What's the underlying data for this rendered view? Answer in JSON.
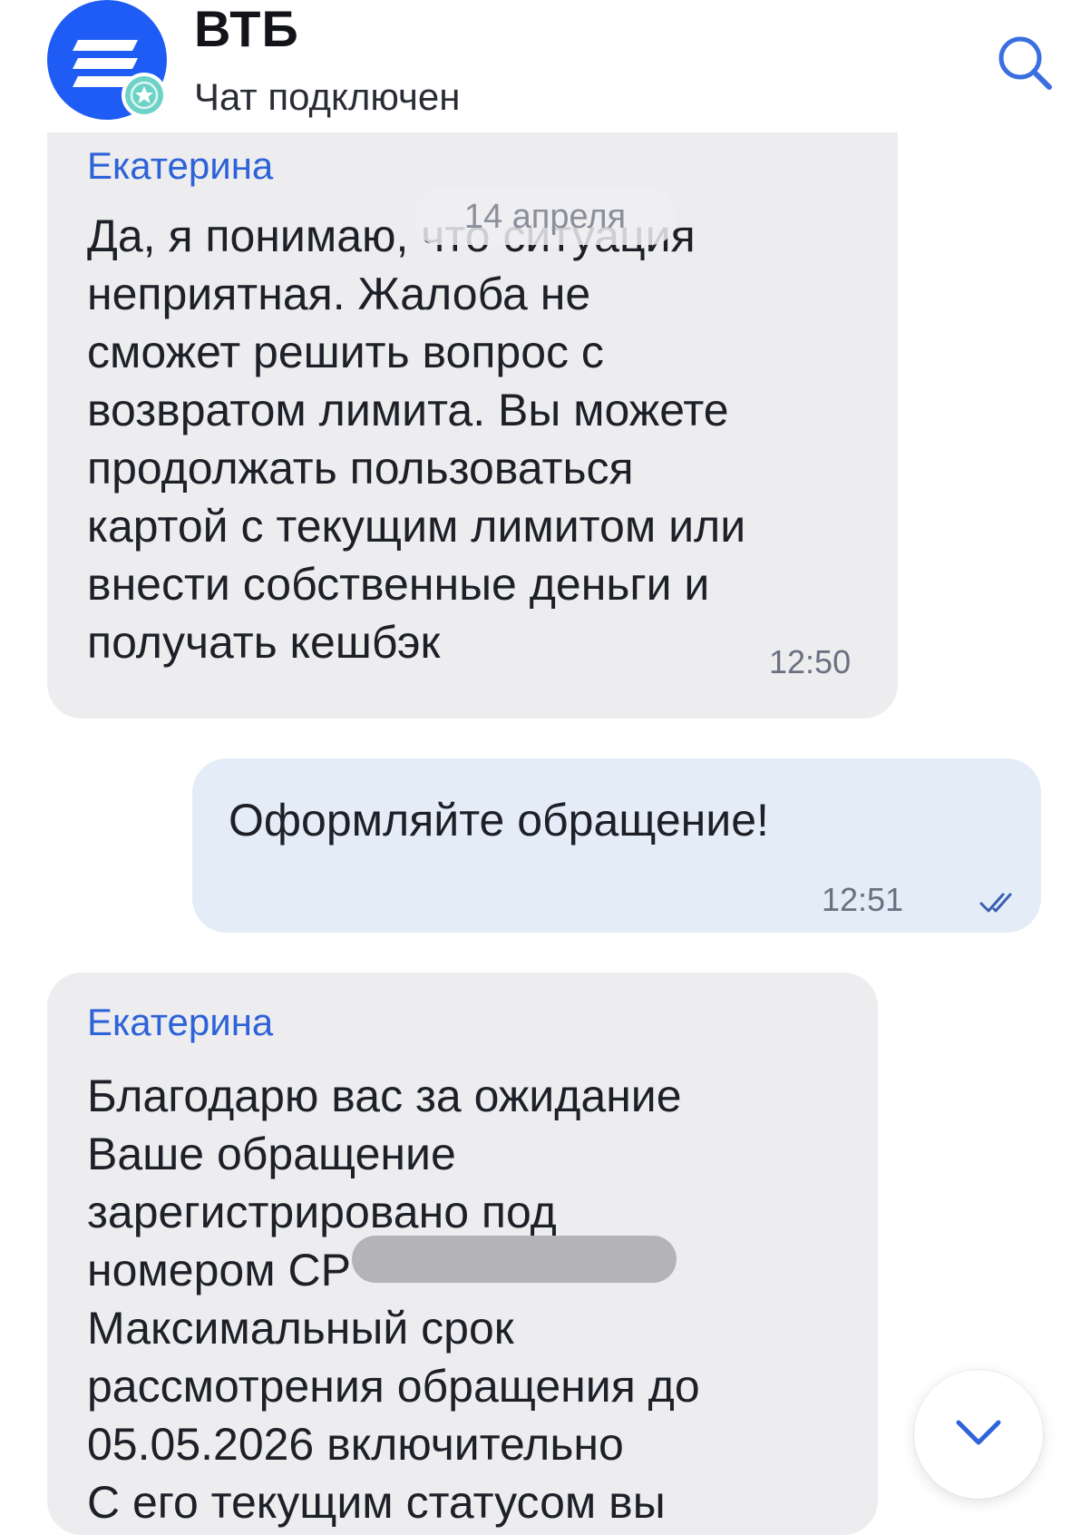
{
  "header": {
    "title": "ВТБ",
    "status": "Чат подключен"
  },
  "messages": [
    {
      "author": "Екатерина",
      "text": "Да, я понимаю, что ситуация\nнеприятная. Жалоба не\nсможет решить вопрос с\nвозвратом лимита. Вы можете\nпродолжать пользоваться\nкартой с текущим лимитом или\nвнести собственные деньги и\nполучать кешбэк",
      "time": "12:50"
    },
    {
      "text": "Оформляйте обращение!",
      "time": "12:51"
    },
    {
      "author": "Екатерина",
      "text": "Благодарю вас за ожидание\nВаше обращение\nзарегистрировано под\nномером CP\nМаксимальный срок\nрассмотрения обращения до\n05.05.2026 включительно\nС его текущим статусом вы"
    }
  ],
  "date_separator": "14 апреля",
  "colors": {
    "brand": "#1f5cf5",
    "author": "#2d62d8",
    "incoming_bubble": "#ededf0",
    "outgoing_bubble": "#e4ecf8"
  },
  "icons": {
    "avatar": "vtb-logo-icon",
    "badge": "verified-star-icon",
    "search": "search-icon",
    "read_receipt": "double-check-icon",
    "scroll_down": "chevron-down-icon"
  }
}
